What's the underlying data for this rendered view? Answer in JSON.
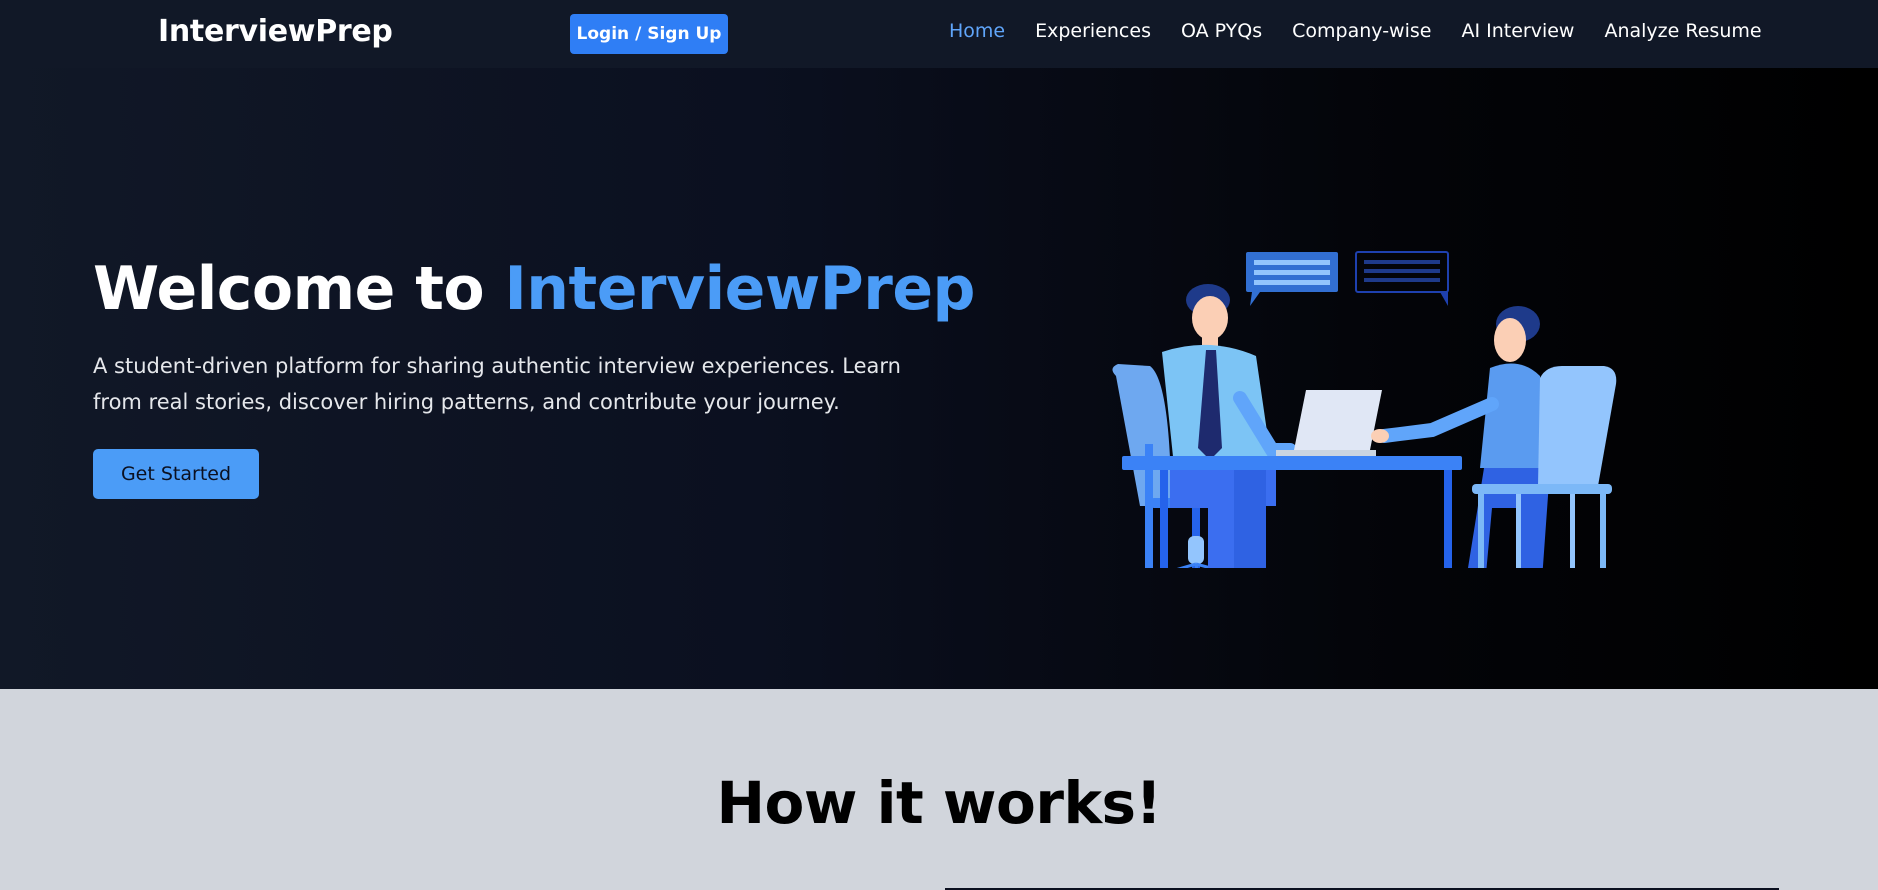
{
  "navbar": {
    "brand": "InterviewPrep",
    "login_label": "Login / Sign Up",
    "links": [
      {
        "label": "Home",
        "active": true
      },
      {
        "label": "Experiences"
      },
      {
        "label": "OA PYQs"
      },
      {
        "label": "Company-wise"
      },
      {
        "label": "AI Interview"
      },
      {
        "label": "Analyze Resume"
      }
    ]
  },
  "hero": {
    "title_prefix": "Welcome to ",
    "title_highlight": "InterviewPrep",
    "subtitle": "A student-driven platform for sharing authentic interview experiences. Learn from real stories, discover hiring patterns, and contribute your journey.",
    "cta_label": "Get Started",
    "illustration_icon": "interview-illustration-icon"
  },
  "how_it_works": {
    "title": "How it works!"
  },
  "colors": {
    "nav_bg": "#111827",
    "accent": "#4b9cf7",
    "login_button": "#2f7ef5",
    "active_link": "#60a5fa",
    "section_bg": "#d1d5dc"
  }
}
